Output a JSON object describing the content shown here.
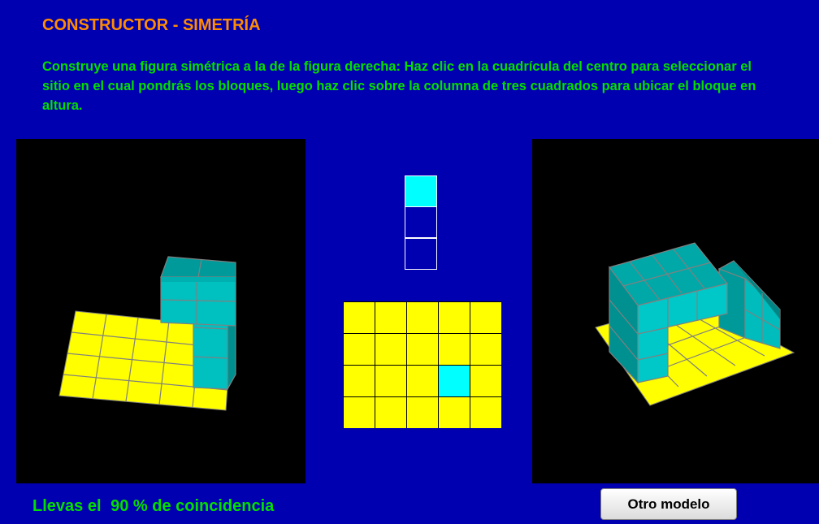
{
  "title": "CONSTRUCTOR - SIMETRÍA",
  "instructions": "Construye una figura simétrica a la de la figura derecha: Haz clic en la cuadrícula del centro para seleccionar el sitio en el cual pondrás los bloques, luego haz clic sobre la columna de tres cuadrados para ubicar el bloque en altura.",
  "height_selector": {
    "levels": 3,
    "selected_level": 3
  },
  "placement_grid": {
    "rows": 4,
    "cols": 5,
    "selected_row": 3,
    "selected_col": 4
  },
  "status": {
    "prefix": "Llevas el",
    "percent": "90",
    "suffix": "% de coincidencia"
  },
  "buttons": {
    "otro_modelo": "Otro modelo"
  },
  "colors": {
    "background": "#0000b0",
    "title": "#ff8c00",
    "text": "#00e000",
    "floor": "#ffff00",
    "block": "#00c8c8",
    "selected": "#00ffff"
  }
}
